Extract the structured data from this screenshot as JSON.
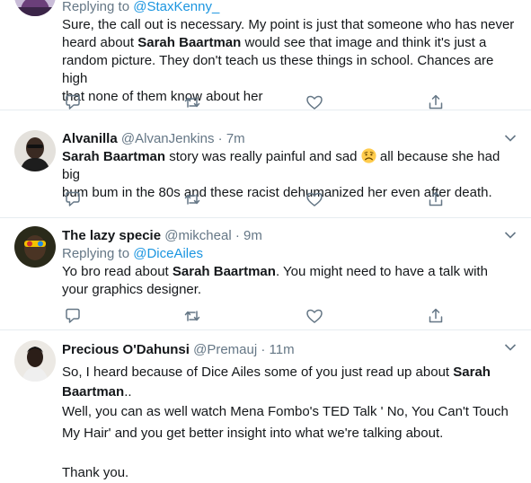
{
  "tweets": [
    {
      "reply_prefix": "Replying to",
      "reply_to": "@StaxKenny_",
      "lines": [
        [
          "Sure, the call out is necessary. My point is just that someone who has never"
        ],
        [
          "heard about ",
          "Sarah Baartman",
          " would see that image and think it's just a"
        ],
        [
          "random picture. They don't teach us these things in school. Chances are high"
        ],
        [
          "that none of them know about her"
        ]
      ]
    },
    {
      "name": "Alvanilla",
      "handle": "@AlvanJenkins",
      "time": "· 7m",
      "lines": [
        [
          "Sarah Baartman",
          " story was really painful and sad ",
          "",
          " all because she had big"
        ],
        [
          "bum bum in the 80s and these racist dehumanized her even after death."
        ]
      ]
    },
    {
      "name": "The lazy specie",
      "handle": "@mikcheal",
      "time": "· 9m",
      "reply_prefix": "Replying to",
      "reply_to": "@DiceAiles",
      "lines": [
        [
          "Yo bro read about ",
          "Sarah Baartman",
          ".  You might need to have a talk with"
        ],
        [
          "your graphics designer."
        ]
      ]
    },
    {
      "name": "Precious O'Dahunsi",
      "handle": "@Premauj",
      "time": "· 11m",
      "lines": [
        [
          "So, I heard because of Dice Ailes some of you just read up about ",
          "Sarah"
        ],
        [
          "Baartman",
          ".."
        ],
        [
          "Well, you can as well watch Mena Fombo's TED Talk ' No, You Can't Touch"
        ],
        [
          "My Hair' and you get better insight into what we're talking about."
        ],
        [
          ""
        ],
        [
          "Thank you."
        ]
      ]
    }
  ],
  "icons": [
    "reply-icon",
    "retweet-icon",
    "like-icon",
    "share-icon",
    "chevron-down-icon",
    "disappointed-face-emoji"
  ],
  "colors": {
    "text": "#14171a",
    "secondary": "#657786",
    "link": "#1b95e0",
    "divider": "#e6ecf0"
  }
}
